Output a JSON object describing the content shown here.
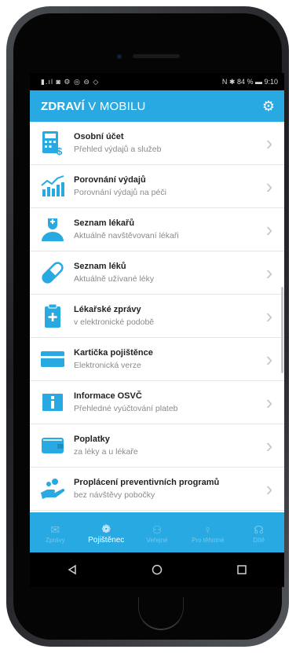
{
  "status": {
    "left": "▮.ıl ◙ ⚙ ◎ ⊖ ◇",
    "right": "N ✱ 84 % ▬ 9:10"
  },
  "header": {
    "title_bold": "ZDRAVÍ",
    "title_rest": " V MOBILU"
  },
  "colors": {
    "accent": "#29a9e1",
    "text_primary": "#222222",
    "text_secondary": "#8a8a8a"
  },
  "items": [
    {
      "title": "Osobní účet",
      "subtitle": "Přehled výdajů a služeb",
      "icon": "calculator-icon"
    },
    {
      "title": "Porovnání výdajů",
      "subtitle": "Porovnání výdajů na péči",
      "icon": "chart-icon"
    },
    {
      "title": "Seznam lékařů",
      "subtitle": "Aktuálně navštěvovaní lékaři",
      "icon": "doctor-icon"
    },
    {
      "title": "Seznam léků",
      "subtitle": "Aktuálně užívané léky",
      "icon": "pill-icon"
    },
    {
      "title": "Lékařské zprávy",
      "subtitle": "v elektronické podobě",
      "icon": "clipboard-icon"
    },
    {
      "title": "Kartička pojištěnce",
      "subtitle": "Elektronická verze",
      "icon": "card-icon"
    },
    {
      "title": "Informace OSVČ",
      "subtitle": "Přehledné vyúčtování plateb",
      "icon": "info-icon"
    },
    {
      "title": "Poplatky",
      "subtitle": "za léky a u lékaře",
      "icon": "wallet-icon"
    },
    {
      "title": "Proplácení preventivních programů",
      "subtitle": "bez návštěvy pobočky",
      "icon": "hand-money-icon"
    }
  ],
  "tabs": [
    {
      "label": "Zprávy",
      "active": false
    },
    {
      "label": "Pojištěnec",
      "active": true
    },
    {
      "label": "Veřejné",
      "active": false
    },
    {
      "label": "Pro těhotné",
      "active": false
    },
    {
      "label": "Dítě",
      "active": false
    }
  ]
}
